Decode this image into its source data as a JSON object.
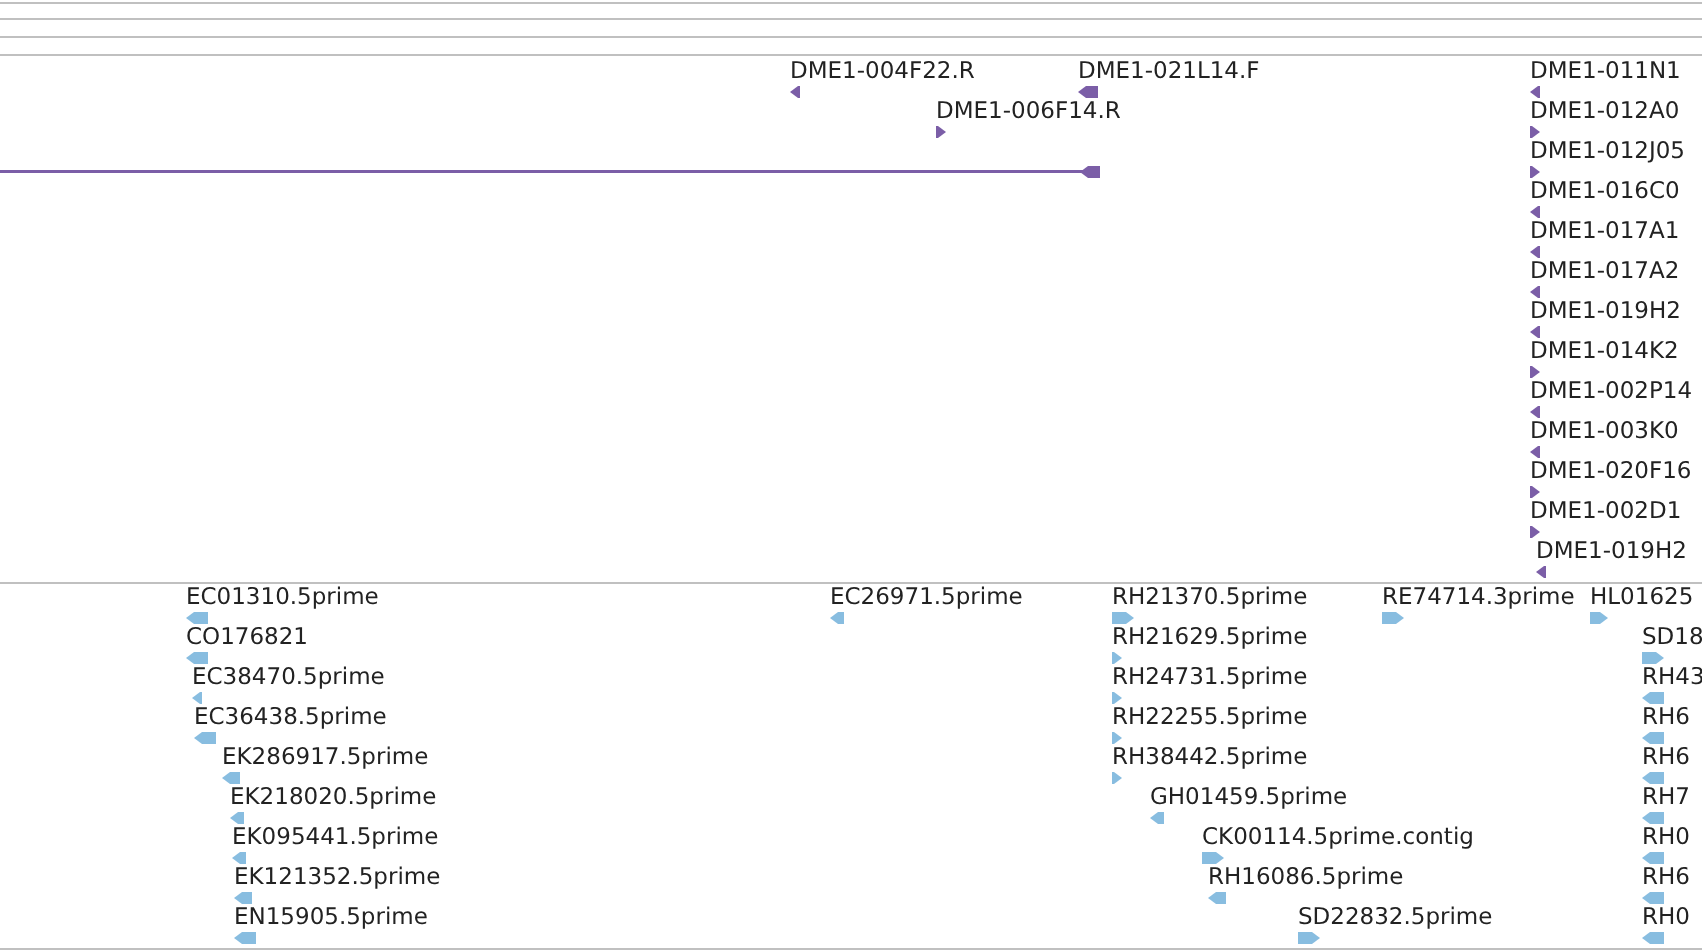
{
  "tracks": [
    {
      "color": "#7b5ea7",
      "features": [
        {
          "kind": "label",
          "label": "DME1-004F22.R",
          "reverse": true
        },
        {
          "kind": "label",
          "label": "DME1-021L14.F",
          "reverse": true
        },
        {
          "kind": "label",
          "label": "DME1-006F14.R",
          "reverse": false
        },
        {
          "kind": "span",
          "reverse": true
        },
        {
          "kind": "label",
          "label": "DME1-011N1",
          "reverse": true
        },
        {
          "kind": "label",
          "label": "DME1-012A0",
          "reverse": false
        },
        {
          "kind": "label",
          "label": "DME1-012J05",
          "reverse": false
        },
        {
          "kind": "label",
          "label": "DME1-016C0",
          "reverse": true
        },
        {
          "kind": "label",
          "label": "DME1-017A1",
          "reverse": true
        },
        {
          "kind": "label",
          "label": "DME1-017A2",
          "reverse": true
        },
        {
          "kind": "label",
          "label": "DME1-019H2",
          "reverse": true
        },
        {
          "kind": "label",
          "label": "DME1-014K2",
          "reverse": false
        },
        {
          "kind": "label",
          "label": "DME1-002P14",
          "reverse": true
        },
        {
          "kind": "label",
          "label": "DME1-003K0",
          "reverse": true
        },
        {
          "kind": "label",
          "label": "DME1-020F16",
          "reverse": false
        },
        {
          "kind": "label",
          "label": "DME1-002D1",
          "reverse": false
        },
        {
          "kind": "label",
          "label": "DME1-019H2",
          "reverse": true
        }
      ]
    },
    {
      "color": "#88bde0",
      "features": [
        {
          "kind": "label",
          "label": "EC01310.5prime",
          "reverse": true
        },
        {
          "kind": "label",
          "label": "CO176821",
          "reverse": true
        },
        {
          "kind": "label",
          "label": "EC38470.5prime",
          "reverse": true
        },
        {
          "kind": "label",
          "label": "EC36438.5prime",
          "reverse": true
        },
        {
          "kind": "label",
          "label": "EK286917.5prime",
          "reverse": true
        },
        {
          "kind": "label",
          "label": "EK218020.5prime",
          "reverse": true
        },
        {
          "kind": "label",
          "label": "EK095441.5prime",
          "reverse": true
        },
        {
          "kind": "label",
          "label": "EK121352.5prime",
          "reverse": true
        },
        {
          "kind": "label",
          "label": "EN15905.5prime",
          "reverse": true
        },
        {
          "kind": "label",
          "label": "EC26971.5prime",
          "reverse": true
        },
        {
          "kind": "label",
          "label": "RH21370.5prime",
          "reverse": false
        },
        {
          "kind": "label",
          "label": "RH21629.5prime",
          "reverse": false
        },
        {
          "kind": "label",
          "label": "RH24731.5prime",
          "reverse": false
        },
        {
          "kind": "label",
          "label": "RH22255.5prime",
          "reverse": false
        },
        {
          "kind": "label",
          "label": "RH38442.5prime",
          "reverse": false
        },
        {
          "kind": "label",
          "label": "GH01459.5prime",
          "reverse": true
        },
        {
          "kind": "label",
          "label": "CK00114.5prime.contig",
          "reverse": false
        },
        {
          "kind": "label",
          "label": "RH16086.5prime",
          "reverse": true
        },
        {
          "kind": "label",
          "label": "SD22832.5prime",
          "reverse": false
        },
        {
          "kind": "label",
          "label": "RE74714.3prime",
          "reverse": false
        },
        {
          "kind": "label",
          "label": "HL01625",
          "reverse": false
        },
        {
          "kind": "label",
          "label": "SD18",
          "reverse": false
        },
        {
          "kind": "label",
          "label": "RH43",
          "reverse": true
        },
        {
          "kind": "label",
          "label": "RH6",
          "reverse": true
        },
        {
          "kind": "label",
          "label": "RH6",
          "reverse": true
        },
        {
          "kind": "label",
          "label": "RH7",
          "reverse": true
        },
        {
          "kind": "label",
          "label": "RH0",
          "reverse": true
        },
        {
          "kind": "label",
          "label": "RH6",
          "reverse": true
        },
        {
          "kind": "label",
          "label": "RH0",
          "reverse": true
        }
      ]
    }
  ]
}
